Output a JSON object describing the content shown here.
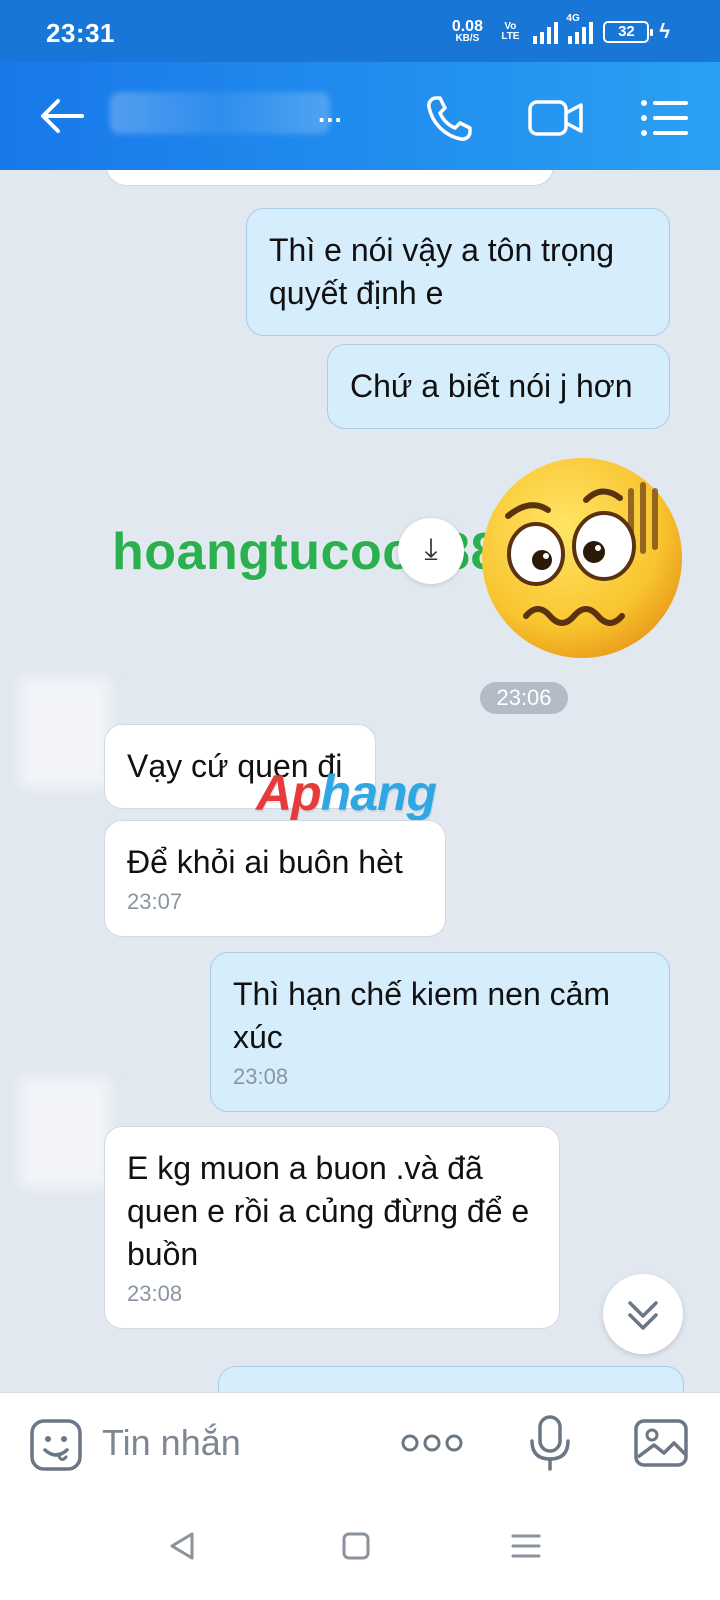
{
  "status_bar": {
    "time": "23:31",
    "speed_value": "0.08",
    "speed_unit": "KB/S",
    "volte_top": "Vo",
    "volte_bottom": "LTE",
    "network_type": "4G",
    "battery": "32"
  },
  "header": {
    "name_suffix": "...",
    "icons": [
      "back-arrow-icon",
      "phone-icon",
      "video-camera-icon",
      "menu-list-icon"
    ]
  },
  "messages": [
    {
      "direction": "out",
      "text": "Thì e nói vậy a tôn trọng quyết định e"
    },
    {
      "direction": "out",
      "text": "Chứ a biết nói j hơn"
    },
    {
      "direction": "out",
      "type": "sticker",
      "icon": "worried-face-sticker"
    },
    {
      "direction": "in",
      "text": "Vạy cứ quen đi"
    },
    {
      "direction": "in",
      "text": "Để khỏi ai buôn hèt",
      "time": "23:07"
    },
    {
      "direction": "out",
      "text": "Thì hạn chế kiem nen cảm xúc",
      "time": "23:08"
    },
    {
      "direction": "in",
      "text": "E kg muon a buon .và đã quen e rồi a củng đừng để e buồn",
      "time": "23:08"
    }
  ],
  "time_divider": "23:06",
  "watermarks": {
    "green": "hoangtucoc8888",
    "brand_part1": "Ap",
    "brand_part2": "hang"
  },
  "input_bar": {
    "placeholder": "Tin nhắn",
    "icons": [
      "emoji-icon",
      "more-icon",
      "microphone-icon",
      "image-icon"
    ]
  },
  "colors": {
    "header_start": "#1878ea",
    "header_end": "#2aa0f2",
    "outgoing_bubble": "#d6edfc",
    "incoming_bubble": "#ffffff",
    "chat_background": "#e2e8f0"
  }
}
